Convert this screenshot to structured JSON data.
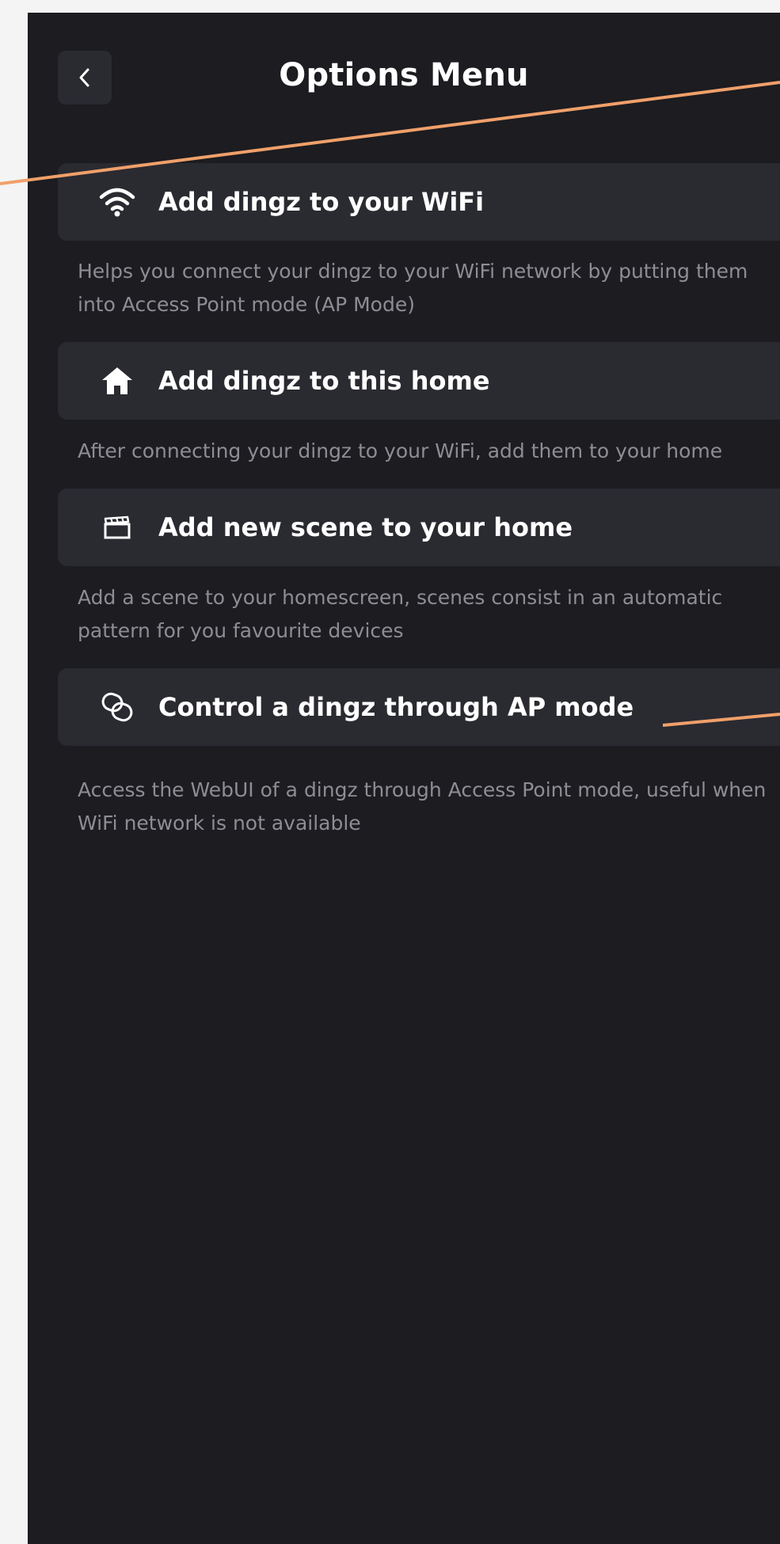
{
  "header": {
    "title": "Options Menu",
    "back_icon": "chevron-left-icon"
  },
  "options": [
    {
      "icon": "wifi-icon",
      "label": "Add dingz to your WiFi",
      "description": "Helps you connect your dingz to your WiFi network by putting them into Access Point mode (AP Mode)"
    },
    {
      "icon": "home-icon",
      "label": "Add dingz to this home",
      "description": "After connecting your dingz to your WiFi, add them to your home"
    },
    {
      "icon": "clapperboard-icon",
      "label": "Add new scene to your home",
      "description": "Add a scene to your homescreen, scenes consist in an automatic pattern for you favourite devices"
    },
    {
      "icon": "link-icon",
      "label": "Control a dingz through AP mode",
      "description": "Access the WebUI of a dingz through Access Point mode, useful when WiFi network is not available"
    }
  ],
  "colors": {
    "background": "#1c1c21",
    "row": "#2a2a31",
    "text": "#ffffff",
    "muted_text": "#8d8d93",
    "annotation": "#f0a06a"
  }
}
